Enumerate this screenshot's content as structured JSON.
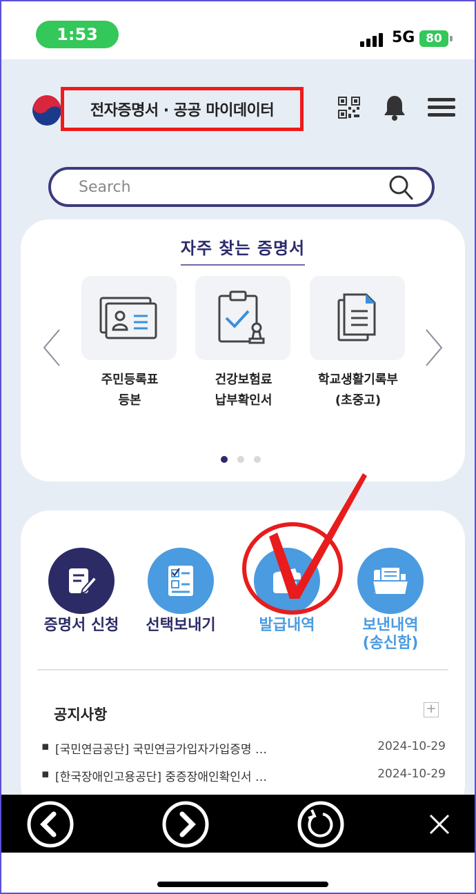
{
  "status_bar": {
    "time": "1:53",
    "network": "5G",
    "battery": "80"
  },
  "header": {
    "title": "전자증명서 · 공공 마이데이터"
  },
  "search": {
    "placeholder": "Search"
  },
  "frequent": {
    "title": "자주 찾는 증명서",
    "items": [
      {
        "label_line1": "주민등록표",
        "label_line2": "등본",
        "icon": "id-card-icon"
      },
      {
        "label_line1": "건강보험료",
        "label_line2": "납부확인서",
        "icon": "clipboard-check-icon"
      },
      {
        "label_line1": "학교생활기록부",
        "label_line2": "(초중고)",
        "icon": "document-icon"
      }
    ],
    "page_count": 3,
    "active_page": 1
  },
  "menu": {
    "items": [
      {
        "label_line1": "증명서 신청",
        "label_line2": "",
        "icon": "pen-paper-icon",
        "color": "#2c2b66"
      },
      {
        "label_line1": "선택보내기",
        "label_line2": "",
        "icon": "checklist-icon",
        "color": "#4a9be0"
      },
      {
        "label_line1": "발급내역",
        "label_line2": "",
        "icon": "wallet-icon",
        "color": "#4a9be0"
      },
      {
        "label_line1": "보낸내역",
        "label_line2": "(송신함)",
        "icon": "folder-icon",
        "color": "#4a9be0"
      }
    ]
  },
  "notices": {
    "title": "공지사항",
    "more": "+",
    "items": [
      {
        "text": "[국민연금공단] 국민연금가입자가입증명 …",
        "date": "2024-10-29"
      },
      {
        "text": "[한국장애인고용공단] 중증장애인확인서 …",
        "date": "2024-10-29"
      }
    ]
  },
  "colors": {
    "annotation": "#e81c1c",
    "brand_navy": "#2c2b66",
    "brand_blue": "#4a9be0"
  }
}
